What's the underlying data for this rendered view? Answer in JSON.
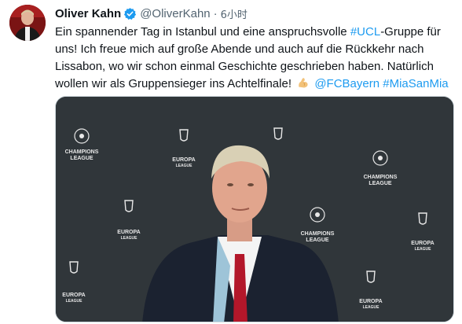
{
  "author": {
    "name": "Oliver Kahn",
    "handle": "@OliverKahn",
    "separator": "·",
    "time": "6小时"
  },
  "tweet": {
    "line1_a": "Ein spannender Tag in Istanbul und eine anspruchsvolle ",
    "line1_tag": "#UCL",
    "line1_b": "-Gruppe für",
    "line2": "uns! Ich freue mich auf große Abende und auch auf die Rückkehr nach",
    "line3": "Lissabon, wo wir schon einmal Geschichte geschrieben haben. Natürlich",
    "line4_a": "wollen wir als Gruppensieger ins Achtelfinale! ",
    "mention": "@FCBayern",
    "hashtag": "#MiaSanMia"
  },
  "backdrop": {
    "champions_line1": "CHAMPIONS",
    "champions_line2": "LEAGUE",
    "europa_line1": "EUROPA",
    "europa_line2": "LEAGUE"
  },
  "colors": {
    "link": "#1d9bf0",
    "verified": "#1d9bf0",
    "backdrop": "#2f3433",
    "muted": "#536471"
  },
  "icons": {
    "verified": "verified-badge-icon",
    "emoji": "flexed-biceps-emoji"
  }
}
